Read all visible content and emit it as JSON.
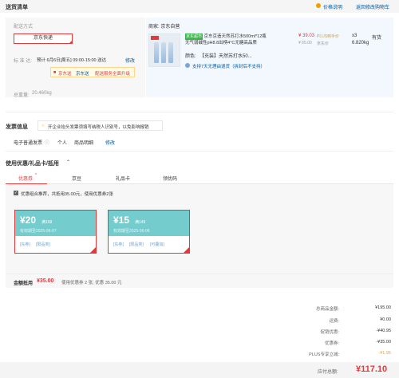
{
  "header": {
    "title": "送货清单",
    "price_help": "价格说明",
    "back_to_cart": "返回修改购物车"
  },
  "shipping": {
    "method_label": "配送方式",
    "method_selected": "京东快递",
    "date_label": "标 准 达:",
    "date_text": "预计 6月6日[周五] 09:00-15:00 送达",
    "modify": "修改",
    "tags": [
      "京东送",
      "京东送",
      "配送服务全面升级"
    ],
    "weight_label": "总重量:",
    "weight_value": "20.460kg"
  },
  "goods": {
    "store": "商家: 京东自营",
    "badge": "京东超市",
    "name_line1": "京东京造天然苏打水500ml*12瓶",
    "name_line2": "无气弱碱性pH8.8出榜4°C无糖高品质",
    "price": "¥ 39.03",
    "price_tag": "PLUS到手价",
    "price_orig": "¥ 65.00",
    "price_orig_tag": "京东价",
    "qty": "x3",
    "stock": "有货",
    "weight": "6.820kg",
    "color_label": "颜色:",
    "color_value": "【充装】天然苏打水50...",
    "support": "支持7天无理由退货（拆封后不支持）"
  },
  "invoice": {
    "title": "发票信息",
    "tip": "开企业抬头发票须填写纳税人识别号，以免影响报销",
    "type": "电子普通发票",
    "person": "个人",
    "detail": "商品明细",
    "modify": "修改"
  },
  "coupons": {
    "title": "使用优惠/礼品卡/抵用",
    "tabs": [
      "优惠券",
      "京豆",
      "礼品卡",
      "领优码"
    ],
    "recommend": "优惠组合推荐，共抵用35.00元，使用优惠券2张",
    "items": [
      {
        "amount": "¥20",
        "cond": "满168",
        "valid": "有效期至2025-06-07",
        "limits": [
          "[东券]",
          "[限品类]"
        ]
      },
      {
        "amount": "¥15",
        "cond": "满149",
        "valid": "有效期至2025-06-06",
        "limits": [
          "[东券]",
          "[限品类]",
          "[可叠加]"
        ]
      }
    ],
    "deduct_label": "金额抵用",
    "deduct_value": "¥35.00",
    "deduct_desc": "使用优惠券 2 张, 优惠 35.00 元"
  },
  "summary": {
    "rows": [
      {
        "label": "总商品金额:",
        "value": "¥195.00",
        "highlight": false
      },
      {
        "label": "运费:",
        "value": "¥0.00",
        "highlight": false
      },
      {
        "label": "促销优惠:",
        "value": "-¥40.95",
        "highlight": false
      },
      {
        "label": "优惠券:",
        "value": "-¥35.00",
        "highlight": false
      },
      {
        "label": "PLUS专享立减:",
        "value": "-¥1.95",
        "highlight": true
      }
    ],
    "total_label": "应付总额:",
    "total_value": "¥117.10"
  },
  "colors": {
    "accent": "#e4393c",
    "link": "#005aa0",
    "coupon": "#74cccd"
  }
}
